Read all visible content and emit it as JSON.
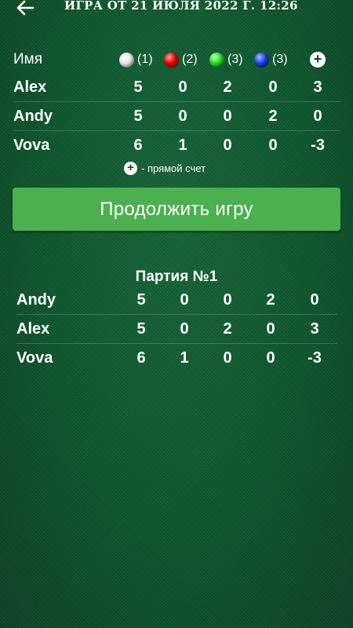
{
  "header": {
    "title": "ИГРА ОТ 21 ИЮЛЯ 2022 Г. 12:26"
  },
  "table": {
    "name_header": "Имя",
    "columns": [
      {
        "ball": "white",
        "label": "(1)"
      },
      {
        "ball": "red",
        "label": "(2)"
      },
      {
        "ball": "green",
        "label": "(3)"
      },
      {
        "ball": "blue",
        "label": "(3)"
      }
    ],
    "rows": [
      {
        "name": "Alex",
        "values": [
          "5",
          "0",
          "2",
          "0",
          "3"
        ]
      },
      {
        "name": "Andy",
        "values": [
          "5",
          "0",
          "0",
          "2",
          "0"
        ]
      },
      {
        "name": "Vova",
        "values": [
          "6",
          "1",
          "0",
          "0",
          "-3"
        ]
      }
    ],
    "hint": "- прямой счет"
  },
  "continue_button": "Продолжить игру",
  "party": {
    "title": "Партия №1",
    "rows": [
      {
        "name": "Andy",
        "values": [
          "5",
          "0",
          "0",
          "2",
          "0"
        ]
      },
      {
        "name": "Alex",
        "values": [
          "5",
          "0",
          "2",
          "0",
          "3"
        ]
      },
      {
        "name": "Vova",
        "values": [
          "6",
          "1",
          "0",
          "0",
          "-3"
        ]
      }
    ]
  },
  "colors": {
    "background": "#0f4a26",
    "button": "#4caf50",
    "text": "#ffffff"
  }
}
